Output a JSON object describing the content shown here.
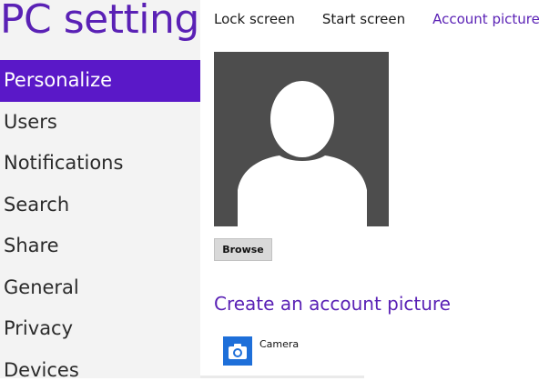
{
  "app": {
    "title": "PC settings"
  },
  "sidebar": {
    "items": [
      {
        "label": "Personalize",
        "selected": true
      },
      {
        "label": "Users"
      },
      {
        "label": "Notifications"
      },
      {
        "label": "Search"
      },
      {
        "label": "Share"
      },
      {
        "label": "General"
      },
      {
        "label": "Privacy"
      },
      {
        "label": "Devices"
      }
    ]
  },
  "main": {
    "tabs": [
      {
        "label": "Lock screen"
      },
      {
        "label": "Start screen"
      },
      {
        "label": "Account picture",
        "active": true
      }
    ],
    "avatar": {
      "icon": "user-silhouette-icon"
    },
    "browse_label": "Browse",
    "create_title": "Create an account picture",
    "apps": [
      {
        "label": "Camera",
        "icon": "camera-icon"
      }
    ]
  },
  "colors": {
    "accent": "#5a21b5",
    "selected_bg": "#5a18c8",
    "sidebar_bg": "#f3f3f3",
    "avatar_bg": "#4d4d4d",
    "camera_tile": "#1e6fd9"
  }
}
